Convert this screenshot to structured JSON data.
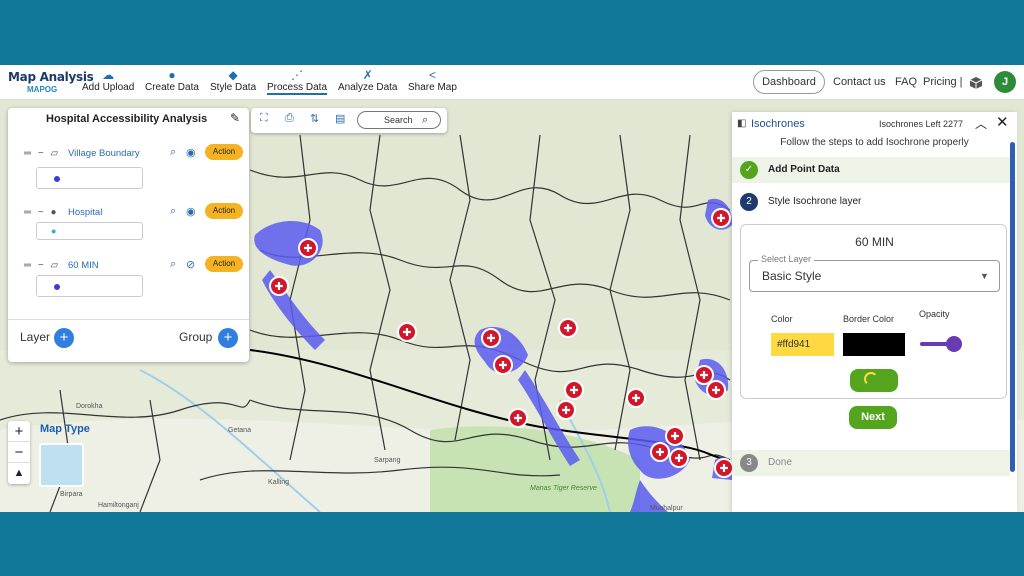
{
  "app": {
    "brand_title": "Map Analysis",
    "brand_sub": "MAPOG"
  },
  "nav": {
    "items": [
      {
        "label": "Add Upload",
        "icon": "cloud-upload-icon"
      },
      {
        "label": "Create Data",
        "icon": "map-pin-icon"
      },
      {
        "label": "Style Data",
        "icon": "paint-bucket-icon"
      },
      {
        "label": "Process Data",
        "icon": "process-icon"
      },
      {
        "label": "Analyze Data",
        "icon": "analyze-icon"
      },
      {
        "label": "Share Map",
        "icon": "share-icon"
      }
    ],
    "active": "Process Data",
    "dashboard": "Dashboard",
    "contact": "Contact us",
    "faq": "FAQ",
    "pricing": "Pricing |",
    "avatar_initial": "J"
  },
  "layers_panel": {
    "title": "Hospital Accessibility Analysis",
    "layers": [
      {
        "name": "Village Boundary",
        "action": "Action",
        "swatch": "#3b3bd6"
      },
      {
        "name": "Hospital",
        "action": "Action",
        "swatch": "#35a6e0"
      },
      {
        "name": "60 MIN",
        "action": "Action",
        "swatch": "#3b3bd6"
      }
    ],
    "footer_layer": "Layer",
    "footer_group": "Group"
  },
  "map_toolbar": {
    "search_label": "Search"
  },
  "map": {
    "map_type_label": "Map Type",
    "place_labels": [
      "Getana",
      "Sarpang",
      "Kalling",
      "Dorokha",
      "Birpara",
      "Hamiltonganj",
      "Manas Tiger Reserve",
      "Mushalpur"
    ]
  },
  "isochrone_panel": {
    "title": "Isochrones",
    "left_label": "Isochrones Left 2277",
    "subtitle": "Follow the steps to add Isochrone properly",
    "steps": [
      {
        "num": "",
        "label": "Add Point Data",
        "state": "done"
      },
      {
        "num": "2",
        "label": "Style Isochrone layer",
        "state": "active"
      },
      {
        "num": "3",
        "label": "Done",
        "state": "pending"
      }
    ],
    "card_title": "60 MIN",
    "select_label": "Select Layer",
    "select_value": "Basic Style",
    "color_label": "Color",
    "border_color_label": "Border Color",
    "opacity_label": "Opacity",
    "color_value": "#ffd941",
    "border_color_value": "#000000",
    "opacity_value": 0.85,
    "next_label": "Next"
  }
}
